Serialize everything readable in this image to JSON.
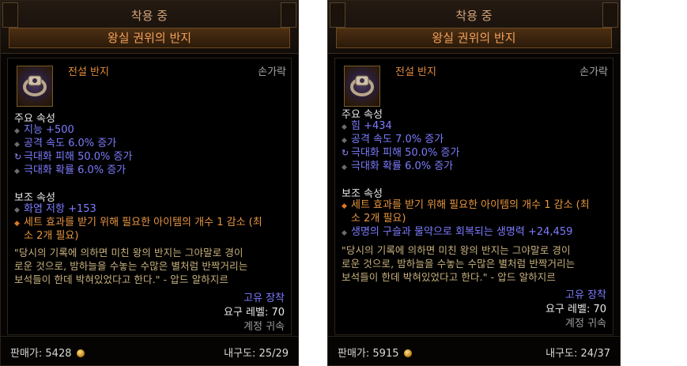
{
  "tooltips": [
    {
      "header": "착용 중",
      "name": "왕실 권위의 반지",
      "type": "전설 반지",
      "slot": "손가락",
      "primary_title": "주요 속성",
      "primary": [
        "지능 +500",
        "공격 속도 6.0% 증가",
        "극대화 피해 50.0% 증가",
        "극대화 확률 6.0% 증가"
      ],
      "secondary_title": "보조 속성",
      "secondary": [
        "화염 저항 +153"
      ],
      "set_line1": "세트 효과를 받기 위해 필요한 아이템의 개수 1 감소 (최",
      "set_line2": "소 2개 필요)",
      "flavor": [
        "\"당시의 기록에 의하면 미친 왕의 반지는 그야말로 경이",
        "로운 것으로, 밤하늘을 수놓는 수많은 별처럼 반짝거리는",
        "보석들이 한데 박혀있었다고 한다.\" - 압드 알하지르"
      ],
      "unique": "고유 장착",
      "level": "요구 레벨: 70",
      "bound": "계정 귀속",
      "sell_label": "판매가:",
      "sell_value": "5428",
      "durability": "내구도: 25/29"
    },
    {
      "header": "착용 중",
      "name": "왕실 권위의 반지",
      "type": "전설 반지",
      "slot": "손가락",
      "primary_title": "주요 속성",
      "primary": [
        "힘 +434",
        "공격 속도 7.0% 증가",
        "극대화 피해 50.0% 증가",
        "극대화 확률 6.0% 증가"
      ],
      "secondary_title": "보조 속성",
      "set_line1": "세트 효과를 받기 위해 필요한 아이템의 개수 1 감소 (최",
      "set_line2": "소 2개 필요)",
      "secondary": [
        "생명의 구슬과 물약으로 회복되는 생명력 +24,459"
      ],
      "flavor": [
        "\"당시의 기록에 의하면 미친 왕의 반지는 그야말로 경이",
        "로운 것으로, 밤하늘을 수놓는 수많은 별처럼 반짝거리는",
        "보석들이 한데 박혀있었다고 한다.\" - 압드 알하지르"
      ],
      "unique": "고유 장착",
      "level": "요구 레벨: 70",
      "bound": "계정 귀속",
      "sell_label": "판매가:",
      "sell_value": "5915",
      "durability": "내구도: 24/37"
    }
  ]
}
